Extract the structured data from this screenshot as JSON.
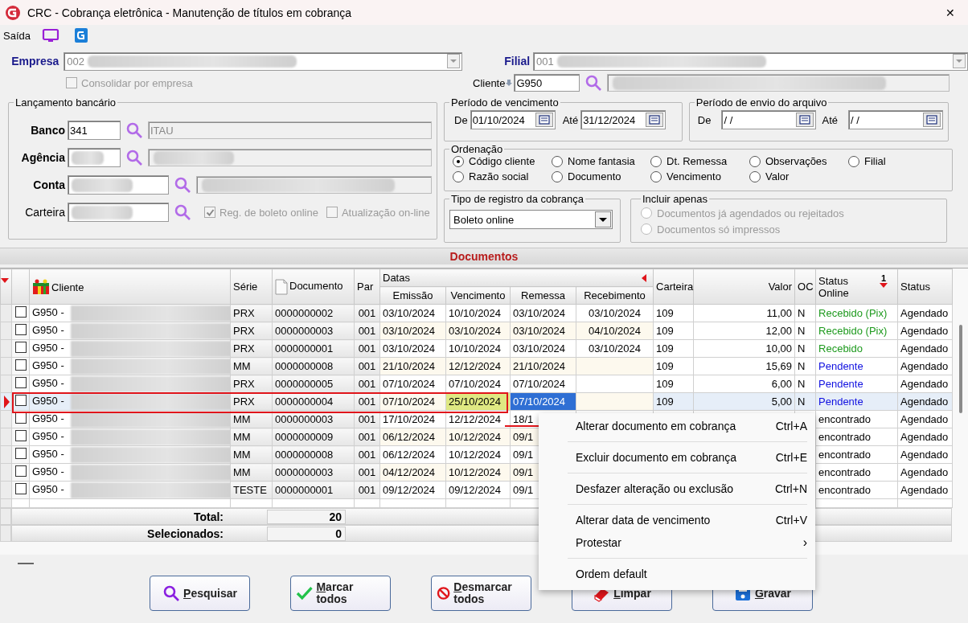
{
  "window": {
    "title": "CRC - Cobrança eletrônica - Manutenção de títulos em cobrança",
    "close": "✕"
  },
  "toolbar": {
    "label": "Saída"
  },
  "empresa": {
    "label": "Empresa",
    "value": "002"
  },
  "consolidar": {
    "label": "Consolidar por empresa",
    "checked": false,
    "disabled": true
  },
  "filial": {
    "label": "Filial",
    "value": "001"
  },
  "cliente": {
    "label": "Cliente",
    "value": "G950"
  },
  "lancamento": {
    "title": "Lançamento bancário",
    "banco": {
      "label": "Banco",
      "value": "341",
      "name": "ITAU"
    },
    "agencia": {
      "label": "Agência"
    },
    "conta": {
      "label": "Conta"
    },
    "carteira": {
      "label": "Carteira"
    },
    "checks": [
      {
        "label": "Reg. de boleto online",
        "checked": true,
        "disabled": true
      },
      {
        "label": "Atualização on-line",
        "checked": false,
        "disabled": true
      }
    ]
  },
  "periodo_vencimento": {
    "title": "Período de vencimento",
    "de_label": "De",
    "de": "01/10/2024",
    "ate_label": "Até",
    "ate": "31/12/2024"
  },
  "periodo_envio": {
    "title": "Período de envio do arquivo",
    "de_label": "De",
    "de": " /  /",
    "ate_label": "Até",
    "ate": " /  /"
  },
  "ordenacao": {
    "title": "Ordenação",
    "options": [
      {
        "label": "Código cliente",
        "selected": true
      },
      {
        "label": "Nome fantasia",
        "selected": false
      },
      {
        "label": "Dt. Remessa",
        "selected": false
      },
      {
        "label": "Observações",
        "selected": false
      },
      {
        "label": "Filial",
        "selected": false
      },
      {
        "label": "Razão social",
        "selected": false
      },
      {
        "label": "Documento",
        "selected": false
      },
      {
        "label": "Vencimento",
        "selected": false
      },
      {
        "label": "Valor",
        "selected": false
      }
    ]
  },
  "tipo_registro": {
    "title": "Tipo de registro da cobrança",
    "value": "Boleto online"
  },
  "incluir_apenas": {
    "title": "Incluir apenas",
    "options": [
      {
        "label": "Documentos já agendados ou rejeitados",
        "selected": false,
        "disabled": true
      },
      {
        "label": "Documentos só impressos",
        "selected": false,
        "disabled": true
      }
    ]
  },
  "documentos": {
    "title": "Documentos",
    "columns": {
      "cliente": "Cliente",
      "serie": "Série",
      "documento": "Documento",
      "par": "Par",
      "datas": "Datas",
      "emissao": "Emissão",
      "vencimento": "Vencimento",
      "remessa": "Remessa",
      "recebimento": "Recebimento",
      "carteira": "Carteira",
      "valor": "Valor",
      "oc": "OC",
      "status_online": "Status Online",
      "sort_order": "1",
      "status": "Status"
    },
    "rows": [
      {
        "selected": false,
        "checked": false,
        "cliente": "G950 -",
        "serie": "PRX",
        "documento": "0000000002",
        "par": "001",
        "emissao": "03/10/2024",
        "vencimento": "10/10/2024",
        "remessa": "03/10/2024",
        "recebimento": "03/10/2024",
        "carteira": "109",
        "valor": "11,00",
        "oc": "N",
        "status_online": "Recebido (Pix)",
        "color": "#1e9a1e",
        "status": "Agendado"
      },
      {
        "selected": false,
        "checked": false,
        "cliente": "G950 -",
        "serie": "PRX",
        "documento": "0000000003",
        "par": "001",
        "emissao": "03/10/2024",
        "vencimento": "03/10/2024",
        "remessa": "03/10/2024",
        "recebimento": "04/10/2024",
        "carteira": "109",
        "valor": "12,00",
        "oc": "N",
        "status_online": "Recebido (Pix)",
        "color": "#1e9a1e",
        "status": "Agendado"
      },
      {
        "selected": false,
        "checked": false,
        "cliente": "G950 -",
        "serie": "PRX",
        "documento": "0000000001",
        "par": "001",
        "emissao": "03/10/2024",
        "vencimento": "10/10/2024",
        "remessa": "03/10/2024",
        "recebimento": "03/10/2024",
        "carteira": "109",
        "valor": "10,00",
        "oc": "N",
        "status_online": "Recebido",
        "color": "#1e9a1e",
        "status": "Agendado"
      },
      {
        "selected": false,
        "checked": false,
        "cliente": "G950 -",
        "serie": "MM",
        "documento": "0000000008",
        "par": "001",
        "emissao": "21/10/2024",
        "vencimento": "12/12/2024",
        "remessa": "21/10/2024",
        "carteira": "109",
        "valor": "15,69",
        "oc": "N",
        "status_online": "Pendente",
        "color": "#1010e0",
        "status": "Agendado"
      },
      {
        "selected": false,
        "checked": false,
        "cliente": "G950 -",
        "serie": "PRX",
        "documento": "0000000005",
        "par": "001",
        "emissao": "07/10/2024",
        "vencimento": "07/10/2024",
        "remessa": "07/10/2024",
        "carteira": "109",
        "valor": "6,00",
        "oc": "N",
        "status_online": "Pendente",
        "color": "#1010e0",
        "status": "Agendado"
      },
      {
        "selected": true,
        "checked": false,
        "cliente": "G950 -",
        "serie": "PRX",
        "documento": "0000000004",
        "par": "001",
        "emissao": "07/10/2024",
        "vencimento": "25/10/2024",
        "remessa": "07/10/2024",
        "carteira": "109",
        "valor": "5,00",
        "oc": "N",
        "status_online": "Pendente",
        "color": "#1010e0",
        "status": "Agendado"
      },
      {
        "selected": false,
        "checked": false,
        "cliente": "G950 -",
        "serie": "MM",
        "documento": "0000000003",
        "par": "001",
        "emissao": "17/10/2024",
        "vencimento": "12/12/2024",
        "remessa": "18/1",
        "status_online": "encontrado",
        "color": "#000000",
        "status": "Agendado"
      },
      {
        "selected": false,
        "checked": false,
        "cliente": "G950 -",
        "serie": "MM",
        "documento": "0000000009",
        "par": "001",
        "emissao": "06/12/2024",
        "vencimento": "10/12/2024",
        "remessa": "09/1",
        "status_online": "encontrado",
        "color": "#000000",
        "status": "Agendado"
      },
      {
        "selected": false,
        "checked": false,
        "cliente": "G950 -",
        "serie": "MM",
        "documento": "0000000008",
        "par": "001",
        "emissao": "06/12/2024",
        "vencimento": "10/12/2024",
        "remessa": "09/1",
        "status_online": "encontrado",
        "color": "#000000",
        "status": "Agendado"
      },
      {
        "selected": false,
        "checked": false,
        "cliente": "G950 -",
        "serie": "MM",
        "documento": "0000000003",
        "par": "001",
        "emissao": "04/12/2024",
        "vencimento": "10/12/2024",
        "remessa": "09/1",
        "status_online": "encontrado",
        "color": "#000000",
        "status": "Agendado"
      },
      {
        "selected": false,
        "checked": false,
        "cliente": "G950 -",
        "serie": "TESTE",
        "documento": "0000000001",
        "par": "001",
        "emissao": "09/12/2024",
        "vencimento": "09/12/2024",
        "remessa": "09/1",
        "status_online": "encontrado",
        "color": "#000000",
        "status": "Agendado"
      }
    ],
    "total_label": "Total:",
    "total": "20",
    "selecionados_label": "Selecionados:",
    "selecionados": "0"
  },
  "context_menu": {
    "items": [
      {
        "kind": "item",
        "label": "Alterar documento em cobrança",
        "shortcut": "Ctrl+A"
      },
      {
        "kind": "separator"
      },
      {
        "kind": "item",
        "label": "Excluir documento em cobrança",
        "shortcut": "Ctrl+E"
      },
      {
        "kind": "separator"
      },
      {
        "kind": "item",
        "label": "Desfazer alteração ou exclusão",
        "shortcut": "Ctrl+N"
      },
      {
        "kind": "separator"
      },
      {
        "kind": "item",
        "label": "Alterar data de vencimento",
        "shortcut": "Ctrl+V"
      },
      {
        "kind": "submenu",
        "label": "Protestar",
        "arrow": "›"
      },
      {
        "kind": "separator"
      },
      {
        "kind": "item",
        "label": "Ordem default"
      }
    ]
  },
  "buttons": [
    {
      "kind": "search",
      "label": "Pesquisar"
    },
    {
      "kind": "check",
      "label": "Marcar todos"
    },
    {
      "kind": "uncheck",
      "label": "Desmarcar todos"
    },
    {
      "kind": "eraser",
      "label": "Limpar"
    },
    {
      "kind": "save",
      "label": "Gravar"
    }
  ]
}
